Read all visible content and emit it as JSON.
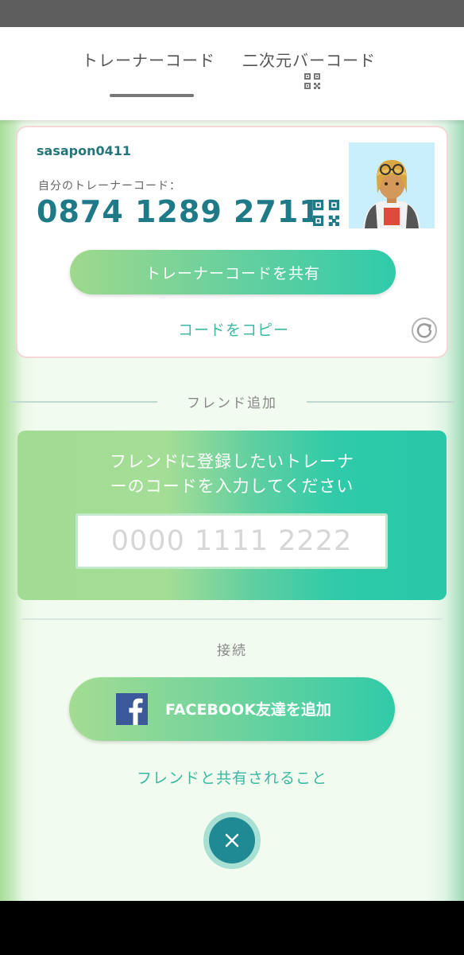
{
  "tabs": [
    {
      "label": "トレーナーコード",
      "active": true
    },
    {
      "label": "二次元バーコード",
      "icon": "qr-code-icon",
      "active": false
    }
  ],
  "trainer": {
    "username": "sasapon0411",
    "code_label": "自分のトレーナーコード：",
    "code": "0874 1289 2711",
    "share_label": "トレーナーコードを共有",
    "copy_label": "コードをコピー"
  },
  "add_friend": {
    "section_title": "フレンド追加",
    "prompt_line1": "フレンドに登録したいトレーナ",
    "prompt_line2": "ーのコードを入力してください",
    "input_placeholder": "0000 1111 2222",
    "input_value": ""
  },
  "connect": {
    "section_title": "接続",
    "facebook_label": "FACEBOOK友達を追加",
    "shared_info_label": "フレンドと共有されること"
  },
  "colors": {
    "accent_teal": "#1e7a86",
    "link_teal": "#3cb7a1",
    "facebook_blue": "#3b5998"
  },
  "icons": [
    "qr-code-icon",
    "refresh-icon",
    "facebook-icon",
    "close-icon"
  ]
}
